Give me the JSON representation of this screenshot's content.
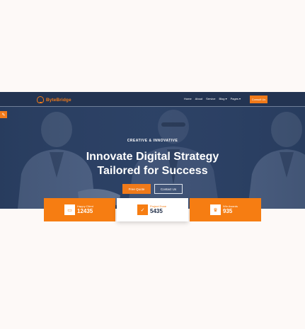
{
  "brand": {
    "name": "ByteBridge",
    "accent": "#f07a1a",
    "navy": "#233452"
  },
  "nav": {
    "links": [
      "Home",
      "About",
      "Service",
      "Blog ▾",
      "Pages ▾"
    ],
    "cta": "Consult Us"
  },
  "hero": {
    "eyebrow": "CREATIVE & INNOVATIVE",
    "headline_line1": "Innovate Digital Strategy",
    "headline_line2": "Tailored for Success",
    "btn_quote": "Free Quote",
    "btn_contact": "Contact Us"
  },
  "stats": [
    {
      "label": "Happy Client",
      "value": "12435",
      "icon": "users-icon"
    },
    {
      "label": "Project Done",
      "value": "5435",
      "icon": "check-icon"
    },
    {
      "label": "Win Awards",
      "value": "935",
      "icon": "award-icon"
    }
  ]
}
